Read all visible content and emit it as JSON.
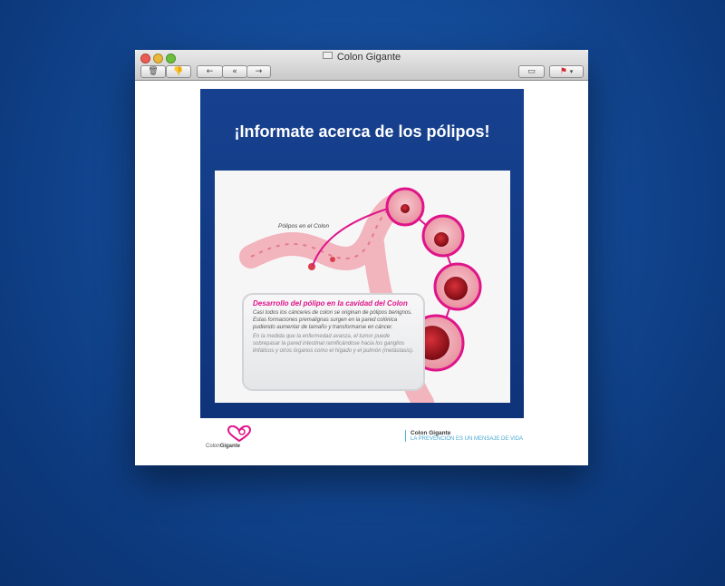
{
  "window": {
    "title": "Colon Gigante"
  },
  "toolbar": {
    "buttons": [
      {
        "name": "delete-button",
        "icon": "trash-icon"
      },
      {
        "name": "junk-button",
        "icon": "thumbs-down-icon"
      },
      {
        "name": "reply-button",
        "icon": "reply-arrow-icon"
      },
      {
        "name": "reply-all-button",
        "icon": "reply-all-arrow-icon"
      },
      {
        "name": "forward-button",
        "icon": "forward-arrow-icon"
      },
      {
        "name": "print-button",
        "icon": "printer-icon"
      },
      {
        "name": "flag-button",
        "icon": "flag-icon"
      }
    ]
  },
  "email": {
    "headline": "¡Informate acerca de los pólipos!",
    "figure": {
      "polyp_label": "Pólipos en el Colon",
      "info_title": "Desarrollo del pólipo en la cavidad del Colon",
      "info_text": "Casi todos los cánceres de colon se originan de pólipos benignos. Estas formaciones premalignas surgen en la pared colónica pudiendo aumentar de tamaño y transformarse en cáncer.",
      "info_text2": "En la medida que la enfermedad avanza, el tumor puede sobrepasar la pared intestinal ramificándose hacia los ganglios linfáticos y otros órganos como el hígado y el pulmón (metástasis)."
    },
    "footer": {
      "logo_text_light": "Colon",
      "logo_text_bold": "Gigante",
      "org_name": "Colon Gigante",
      "slogan": "LA PREVENCIÓN ES UN MENSAJE DE VIDA"
    }
  },
  "colors": {
    "background_blue": "#134a97",
    "hero_blue": "#113983",
    "accent_magenta": "#e0148a",
    "footer_accent": "#4aa9d3"
  }
}
